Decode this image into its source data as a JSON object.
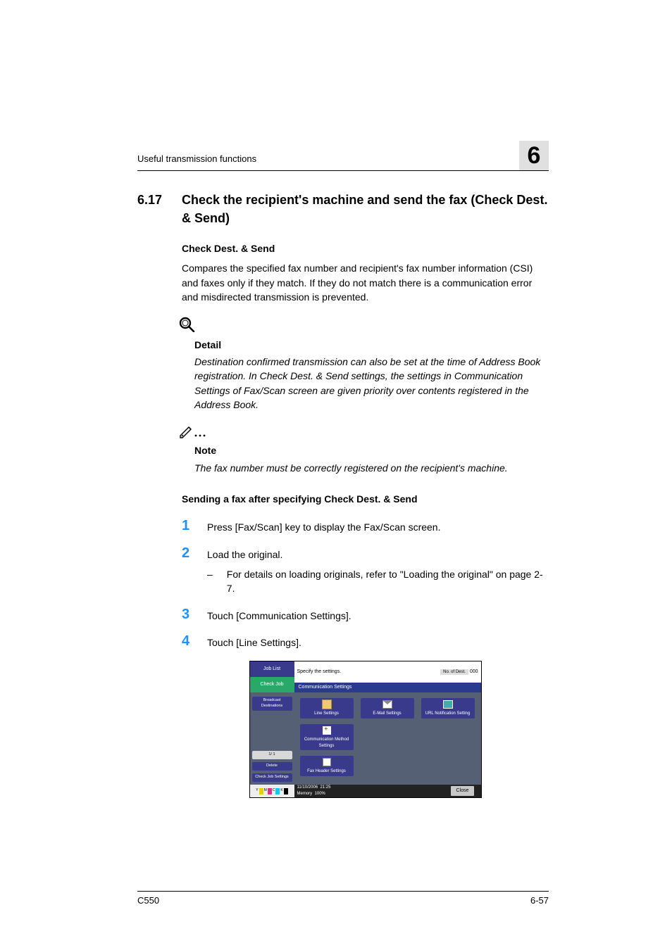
{
  "header": {
    "running_head": "Useful transmission functions",
    "chapter_number": "6"
  },
  "section": {
    "number": "6.17",
    "title": "Check the recipient's machine and send the fax (Check Dest. & Send)"
  },
  "sub1_heading": "Check Dest. & Send",
  "sub1_para": "Compares the specified fax number and recipient's fax number information (CSI) and faxes only if they match. If they do not match there is a communication error and misdirected transmission is prevented.",
  "detail": {
    "title": "Detail",
    "body": "Destination confirmed transmission can also be set at the time of Address Book registration. In Check Dest. & Send settings, the settings in Communication Settings of Fax/Scan screen are given priority over contents registered in the Address Book."
  },
  "note": {
    "title": "Note",
    "body": "The fax number must be correctly registered on the recipient's machine."
  },
  "procedure_heading": "Sending a fax after specifying Check Dest. & Send",
  "steps": {
    "s1": {
      "n": "1",
      "text": "Press [Fax/Scan] key to display the Fax/Scan screen."
    },
    "s2": {
      "n": "2",
      "text": "Load the original.",
      "sub": "For details on loading originals, refer to \"Loading the original\" on page 2-7."
    },
    "s3": {
      "n": "3",
      "text": "Touch [Communication Settings]."
    },
    "s4": {
      "n": "4",
      "text": "Touch [Line Settings]."
    }
  },
  "screen": {
    "job_list": "Job List",
    "check_job": "Check Job",
    "prompt": "Specify the settings.",
    "count_label": "No. of\nDest.",
    "count_value": "000",
    "panel_title": "Communication Settings",
    "left": {
      "broadcast": "Broadcast\nDestinations",
      "pager": "1/  1",
      "delete": "Delete",
      "check_settings": "Check Job\nSettings"
    },
    "buttons": {
      "line": "Line Settings",
      "email": "E-Mail\nSettings",
      "url": "URL Notification\nSetting",
      "method": "Communication Method\nSettings",
      "fax_header": "Fax Header\nSettings"
    },
    "footer": {
      "date": "11/10/2006",
      "time": "21:25",
      "memory_label": "Memory",
      "memory_value": "100%",
      "close": "Close"
    }
  },
  "page_footer": {
    "model": "C550",
    "page": "6-57"
  }
}
